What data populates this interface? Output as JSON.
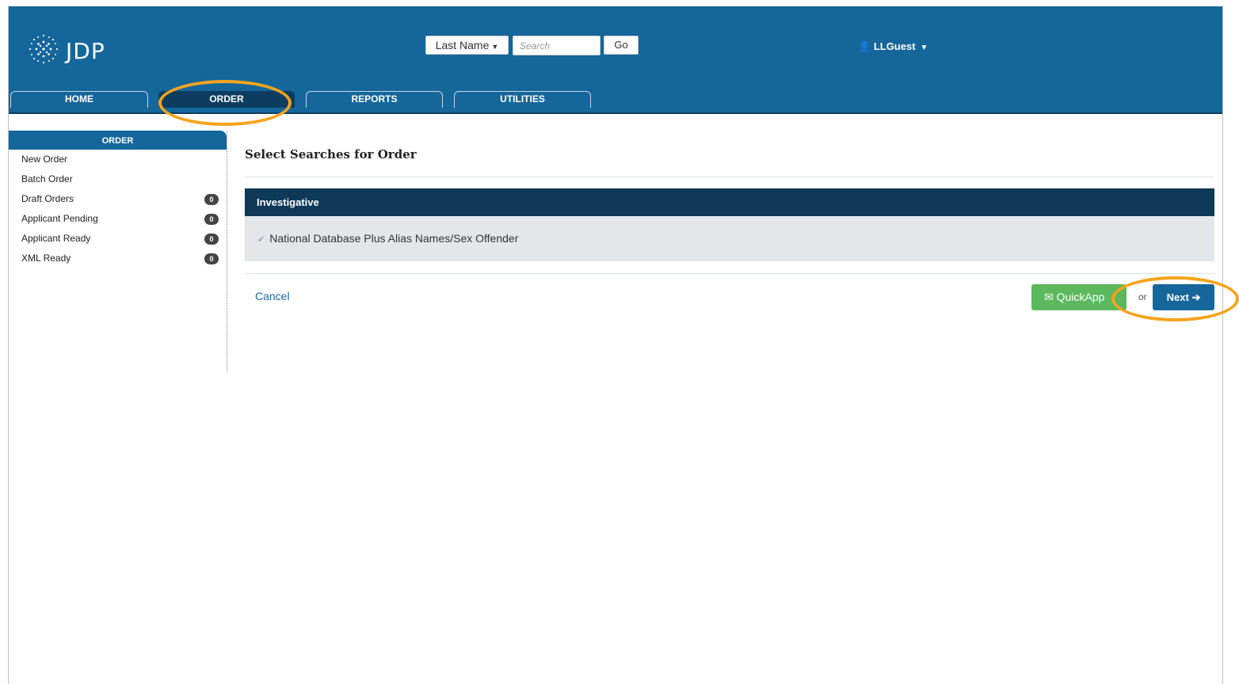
{
  "app": {
    "logo_text": "JDP"
  },
  "search": {
    "select_label": "Last Name",
    "placeholder": "Search",
    "go_label": "Go"
  },
  "user": {
    "name": "LLGuest"
  },
  "tabs": [
    {
      "label": "HOME"
    },
    {
      "label": "ORDER"
    },
    {
      "label": "REPORTS"
    },
    {
      "label": "UTILITIES"
    }
  ],
  "sidebar": {
    "header": "ORDER",
    "items": [
      {
        "label": "New Order"
      },
      {
        "label": "Batch Order"
      },
      {
        "label": "Draft Orders",
        "count": "0"
      },
      {
        "label": "Applicant Pending",
        "count": "0"
      },
      {
        "label": "Applicant Ready",
        "count": "0"
      },
      {
        "label": "XML Ready",
        "count": "0"
      }
    ]
  },
  "main": {
    "title": "Select Searches for Order",
    "section": {
      "heading": "Investigative",
      "option_label": "National Database Plus Alias Names/Sex Offender",
      "option_checked": true
    },
    "cancel_label": "Cancel",
    "quickapp_label": "QuickApp",
    "or_label": "or",
    "next_label": "Next"
  },
  "colors": {
    "brand": "#15669b",
    "dark": "#0e3858",
    "success": "#5cb85c",
    "highlight": "#f4a41f"
  }
}
